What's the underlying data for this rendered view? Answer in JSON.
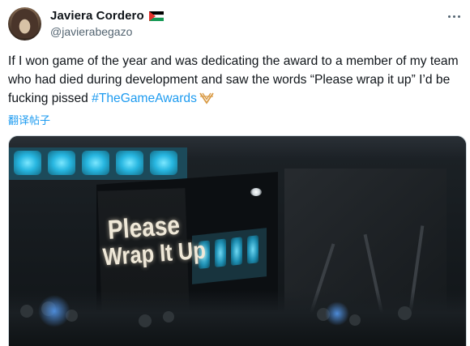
{
  "author": {
    "display_name": "Javiera Cordero",
    "handle": "@javierabegazo",
    "flag_icon": "palestine-flag-icon",
    "avatar_icon": "avatar"
  },
  "tweet": {
    "text_before": "If I won game of the year and was dedicating the award to a member of my team who had died during development and saw the words “Please wrap it up” I’d be fucking pissed ",
    "hashtag": "#TheGameAwards",
    "hashtag_icon": "the-game-awards-icon",
    "translate_label": "翻译帖子"
  },
  "media": {
    "screen_line1": "Please",
    "screen_line2": "Wrap It Up"
  },
  "colors": {
    "link": "#1d9bf0",
    "secondary_text": "#536471",
    "hashtag_icon_color": "#d99b46"
  }
}
